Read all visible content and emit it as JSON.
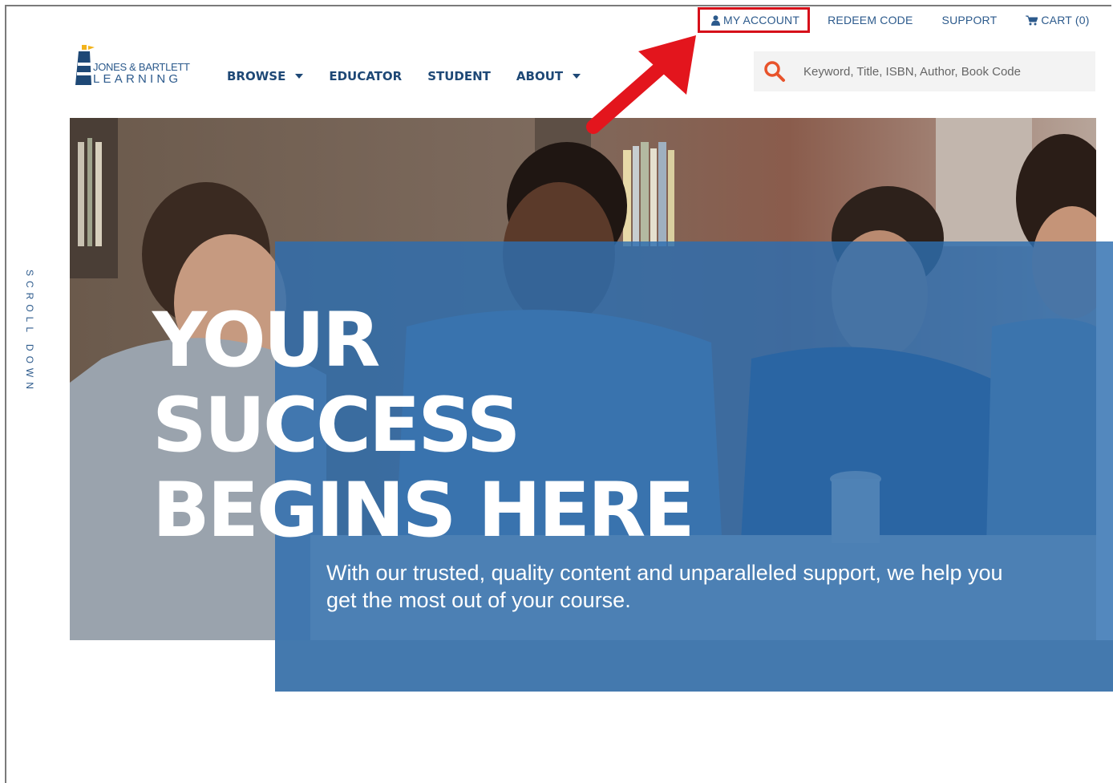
{
  "utility_nav": {
    "my_account": "MY ACCOUNT",
    "redeem_code": "REDEEM CODE",
    "support": "SUPPORT",
    "cart": "CART (0)"
  },
  "logo": {
    "line1": "JONES & BARTLETT",
    "line2": "LEARNING"
  },
  "main_nav": {
    "browse": "BROWSE",
    "educator": "EDUCATOR",
    "student": "STUDENT",
    "about": "ABOUT"
  },
  "search": {
    "placeholder": "Keyword, Title, ISBN, Author, Book Code"
  },
  "hero": {
    "headline_line1": "YOUR",
    "headline_line2": "SUCCESS",
    "headline_line3": "BEGINS HERE",
    "subhead": "With our trusted, quality content and unparalleled support, we help you get the most out of your course."
  },
  "scroll_label": "SCROLL DOWN",
  "colors": {
    "brand_navy": "#1e4876",
    "brand_blue": "#2c5a8c",
    "hero_overlay": "#2d6eb0",
    "search_icon": "#e8532b",
    "highlight": "#d6101a"
  }
}
